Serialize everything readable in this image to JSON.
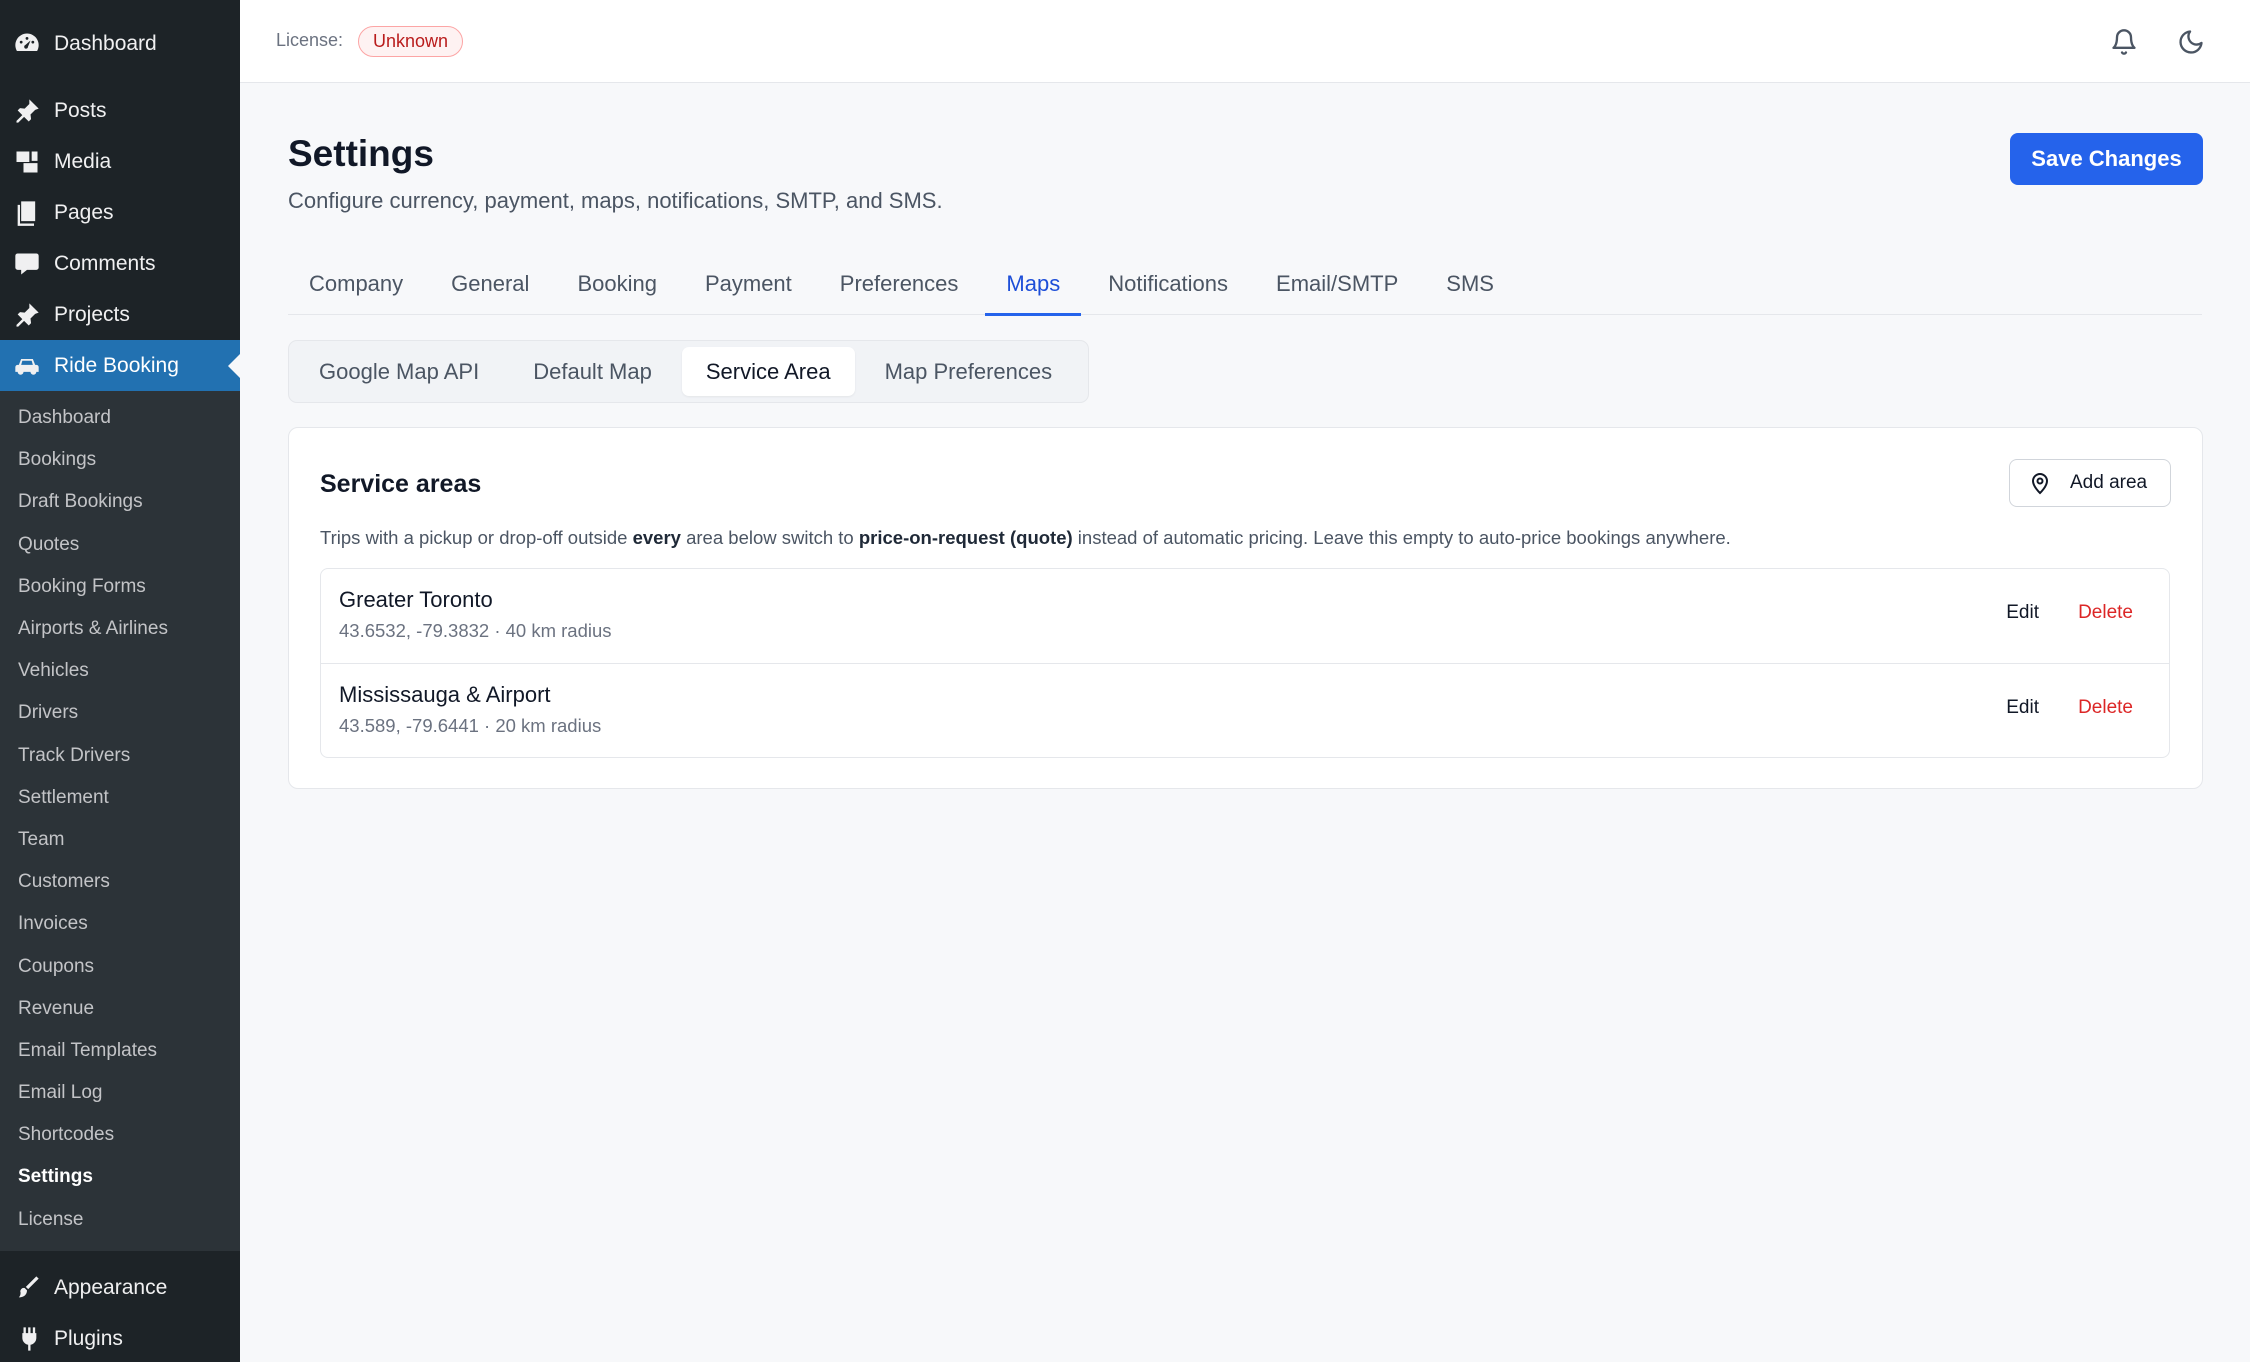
{
  "sidebar": {
    "top_items": [
      {
        "label": "Dashboard",
        "icon": "dashboard-icon"
      },
      {
        "label": "Posts",
        "icon": "pin-icon"
      },
      {
        "label": "Media",
        "icon": "media-icon"
      },
      {
        "label": "Pages",
        "icon": "pages-icon"
      },
      {
        "label": "Comments",
        "icon": "comment-icon"
      },
      {
        "label": "Projects",
        "icon": "pin-icon"
      },
      {
        "label": "Ride Booking",
        "icon": "car-icon"
      }
    ],
    "sub_items": [
      "Dashboard",
      "Bookings",
      "Draft Bookings",
      "Quotes",
      "Booking Forms",
      "Airports & Airlines",
      "Vehicles",
      "Drivers",
      "Track Drivers",
      "Settlement",
      "Team",
      "Customers",
      "Invoices",
      "Coupons",
      "Revenue",
      "Email Templates",
      "Email Log",
      "Shortcodes",
      "Settings",
      "License"
    ],
    "bottom_items": [
      {
        "label": "Appearance",
        "icon": "brush-icon"
      },
      {
        "label": "Plugins",
        "icon": "plug-icon"
      }
    ]
  },
  "topbar": {
    "license_label": "License:",
    "license_status": "Unknown"
  },
  "header": {
    "title": "Settings",
    "subtitle": "Configure currency, payment, maps, notifications, SMTP, and SMS.",
    "save_label": "Save Changes"
  },
  "tabs": [
    "Company",
    "General",
    "Booking",
    "Payment",
    "Preferences",
    "Maps",
    "Notifications",
    "Email/SMTP",
    "SMS"
  ],
  "active_tab": "Maps",
  "subtabs": [
    "Google Map API",
    "Default Map",
    "Service Area",
    "Map Preferences"
  ],
  "active_subtab": "Service Area",
  "service_areas": {
    "title": "Service areas",
    "add_label": "Add area",
    "desc_1": "Trips with a pickup or drop-off outside ",
    "desc_bold_1": "every",
    "desc_2": " area below switch to ",
    "desc_bold_2": "price-on-request (quote)",
    "desc_3": " instead of automatic pricing. Leave this empty to auto-price bookings anywhere.",
    "areas": [
      {
        "name": "Greater Toronto",
        "meta": "43.6532, -79.3832 · 40 km radius",
        "edit": "Edit",
        "delete": "Delete"
      },
      {
        "name": "Mississauga & Airport",
        "meta": "43.589, -79.6441 · 20 km radius",
        "edit": "Edit",
        "delete": "Delete"
      }
    ]
  },
  "colors": {
    "accent": "#2563eb",
    "sidebar": "#1d2327",
    "active_menu": "#2271b1",
    "danger": "#dc2626"
  }
}
